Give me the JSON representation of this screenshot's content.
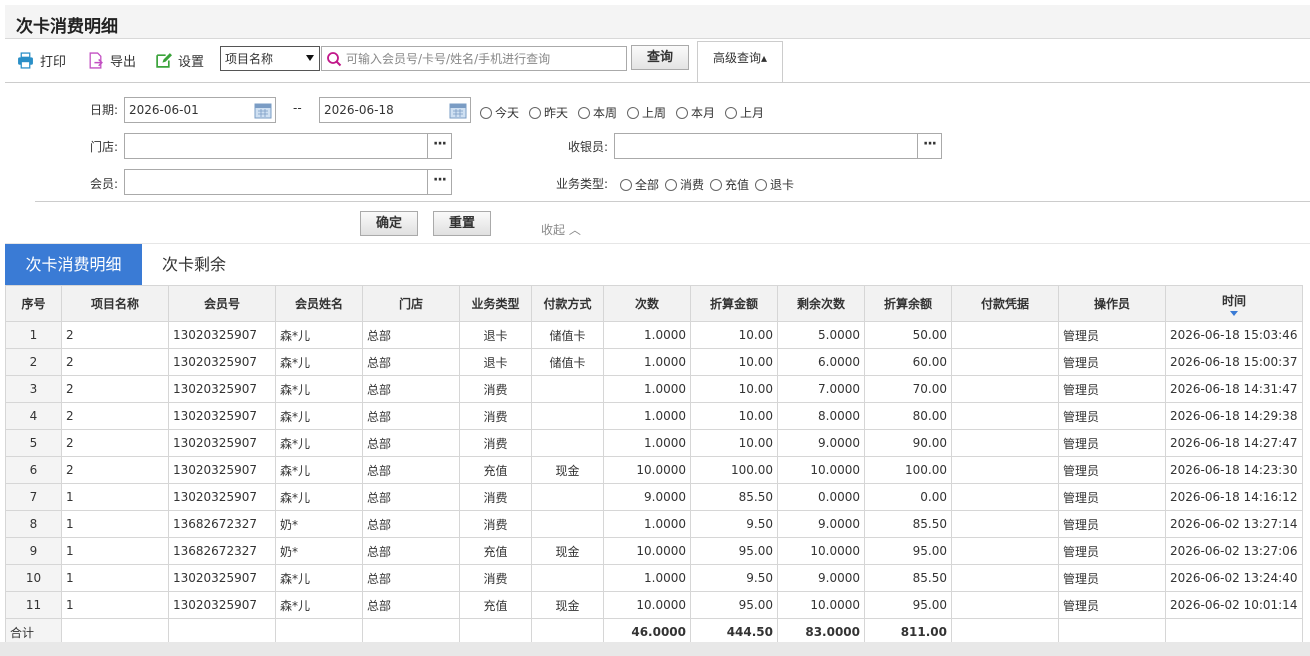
{
  "page": {
    "title": "次卡消费明细"
  },
  "toolbar": {
    "print_label": "打印",
    "export_label": "导出",
    "settings_label": "设置",
    "search_field_select": "项目名称",
    "search_placeholder": "可输入会员号/卡号/姓名/手机进行查询",
    "query_label": "查询",
    "advanced_label": "高级查询▴"
  },
  "filters": {
    "date_label": "日期:",
    "date_from": "2026-06-01",
    "date_sep": "--",
    "date_to": "2026-06-18",
    "date_shortcuts": [
      "今天",
      "昨天",
      "本周",
      "上周",
      "本月",
      "上月"
    ],
    "store_label": "门店:",
    "store_value": "",
    "cashier_label": "收银员:",
    "cashier_value": "",
    "member_label": "会员:",
    "member_value": "",
    "biz_type_label": "业务类型:",
    "biz_types": [
      "全部",
      "消费",
      "充值",
      "退卡"
    ],
    "confirm_label": "确定",
    "reset_label": "重置",
    "collapse_label": "收起 ︿"
  },
  "tabs": [
    {
      "label": "次卡消费明细",
      "active": true
    },
    {
      "label": "次卡剩余",
      "active": false
    }
  ],
  "colors": {
    "accent": "#3a7bd5",
    "header_bg": "#f2f2f2"
  },
  "table": {
    "columns": [
      "序号",
      "项目名称",
      "会员号",
      "会员姓名",
      "门店",
      "业务类型",
      "付款方式",
      "次数",
      "折算金额",
      "剩余次数",
      "折算余额",
      "付款凭据",
      "操作员",
      "时间"
    ],
    "sorted_column": "时间",
    "rows": [
      [
        "1",
        "2",
        "13020325907",
        "森*儿",
        "总部",
        "退卡",
        "储值卡",
        "1.0000",
        "10.00",
        "5.0000",
        "50.00",
        "",
        "管理员",
        "2026-06-18 15:03:46"
      ],
      [
        "2",
        "2",
        "13020325907",
        "森*儿",
        "总部",
        "退卡",
        "储值卡",
        "1.0000",
        "10.00",
        "6.0000",
        "60.00",
        "",
        "管理员",
        "2026-06-18 15:00:37"
      ],
      [
        "3",
        "2",
        "13020325907",
        "森*儿",
        "总部",
        "消费",
        "",
        "1.0000",
        "10.00",
        "7.0000",
        "70.00",
        "",
        "管理员",
        "2026-06-18 14:31:47"
      ],
      [
        "4",
        "2",
        "13020325907",
        "森*儿",
        "总部",
        "消费",
        "",
        "1.0000",
        "10.00",
        "8.0000",
        "80.00",
        "",
        "管理员",
        "2026-06-18 14:29:38"
      ],
      [
        "5",
        "2",
        "13020325907",
        "森*儿",
        "总部",
        "消费",
        "",
        "1.0000",
        "10.00",
        "9.0000",
        "90.00",
        "",
        "管理员",
        "2026-06-18 14:27:47"
      ],
      [
        "6",
        "2",
        "13020325907",
        "森*儿",
        "总部",
        "充值",
        "现金",
        "10.0000",
        "100.00",
        "10.0000",
        "100.00",
        "",
        "管理员",
        "2026-06-18 14:23:30"
      ],
      [
        "7",
        "1",
        "13020325907",
        "森*儿",
        "总部",
        "消费",
        "",
        "9.0000",
        "85.50",
        "0.0000",
        "0.00",
        "",
        "管理员",
        "2026-06-18 14:16:12"
      ],
      [
        "8",
        "1",
        "13682672327",
        "奶*",
        "总部",
        "消费",
        "",
        "1.0000",
        "9.50",
        "9.0000",
        "85.50",
        "",
        "管理员",
        "2026-06-02 13:27:14"
      ],
      [
        "9",
        "1",
        "13682672327",
        "奶*",
        "总部",
        "充值",
        "现金",
        "10.0000",
        "95.00",
        "10.0000",
        "95.00",
        "",
        "管理员",
        "2026-06-02 13:27:06"
      ],
      [
        "10",
        "1",
        "13020325907",
        "森*儿",
        "总部",
        "消费",
        "",
        "1.0000",
        "9.50",
        "9.0000",
        "85.50",
        "",
        "管理员",
        "2026-06-02 13:24:40"
      ],
      [
        "11",
        "1",
        "13020325907",
        "森*儿",
        "总部",
        "充值",
        "现金",
        "10.0000",
        "95.00",
        "10.0000",
        "95.00",
        "",
        "管理员",
        "2026-06-02 10:01:14"
      ]
    ],
    "total": [
      "合计",
      "",
      "",
      "",
      "",
      "",
      "",
      "46.0000",
      "444.50",
      "83.0000",
      "811.00",
      "",
      "",
      ""
    ]
  }
}
